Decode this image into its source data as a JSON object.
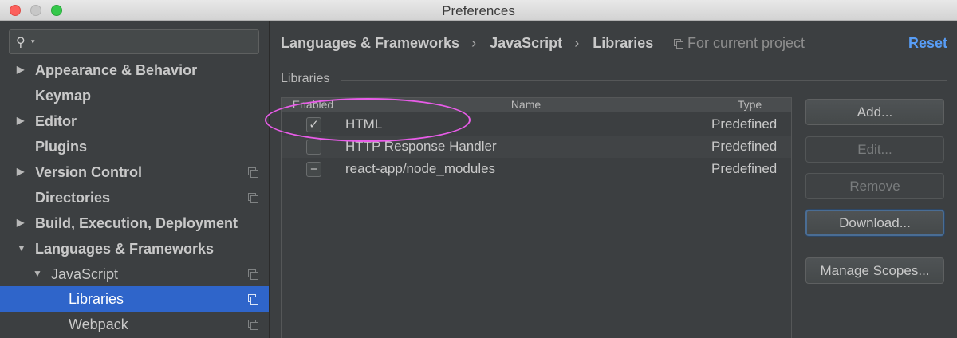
{
  "window": {
    "title": "Preferences"
  },
  "search": {
    "icon": "search-icon"
  },
  "sidebar": {
    "items": [
      {
        "label": "Appearance & Behavior",
        "expandable": true,
        "copy_icon": false
      },
      {
        "label": "Keymap",
        "expandable": false,
        "copy_icon": false
      },
      {
        "label": "Editor",
        "expandable": true,
        "copy_icon": false
      },
      {
        "label": "Plugins",
        "expandable": false,
        "copy_icon": false
      },
      {
        "label": "Version Control",
        "expandable": true,
        "copy_icon": true
      },
      {
        "label": "Directories",
        "expandable": false,
        "copy_icon": true
      },
      {
        "label": "Build, Execution, Deployment",
        "expandable": true,
        "copy_icon": false
      },
      {
        "label": "Languages & Frameworks",
        "expandable": true,
        "expanded": true,
        "copy_icon": false
      },
      {
        "label": "JavaScript",
        "expandable": true,
        "expanded": true,
        "copy_icon": true
      },
      {
        "label": "Libraries",
        "selected": true,
        "copy_icon": true
      },
      {
        "label": "Webpack",
        "copy_icon": true
      }
    ]
  },
  "header": {
    "breadcrumb": [
      "Languages & Frameworks",
      "JavaScript",
      "Libraries"
    ],
    "separator": "›",
    "scope": "For current project",
    "reset": "Reset"
  },
  "libraries": {
    "title": "Libraries",
    "columns": [
      "Enabled",
      "Name",
      "Type"
    ],
    "rows": [
      {
        "enabled": "✓",
        "name": "HTML",
        "type": "Predefined"
      },
      {
        "enabled": "",
        "name": "HTTP Response Handler",
        "type": "Predefined"
      },
      {
        "enabled": "−",
        "name": "react-app/node_modules",
        "type": "Predefined"
      }
    ]
  },
  "buttons": {
    "add": "Add...",
    "edit": "Edit...",
    "remove": "Remove",
    "download": "Download...",
    "manage_scopes": "Manage Scopes..."
  },
  "colors": {
    "selection": "#2f65ca",
    "accent_link": "#589df6",
    "annotation": "#e85ce8"
  }
}
